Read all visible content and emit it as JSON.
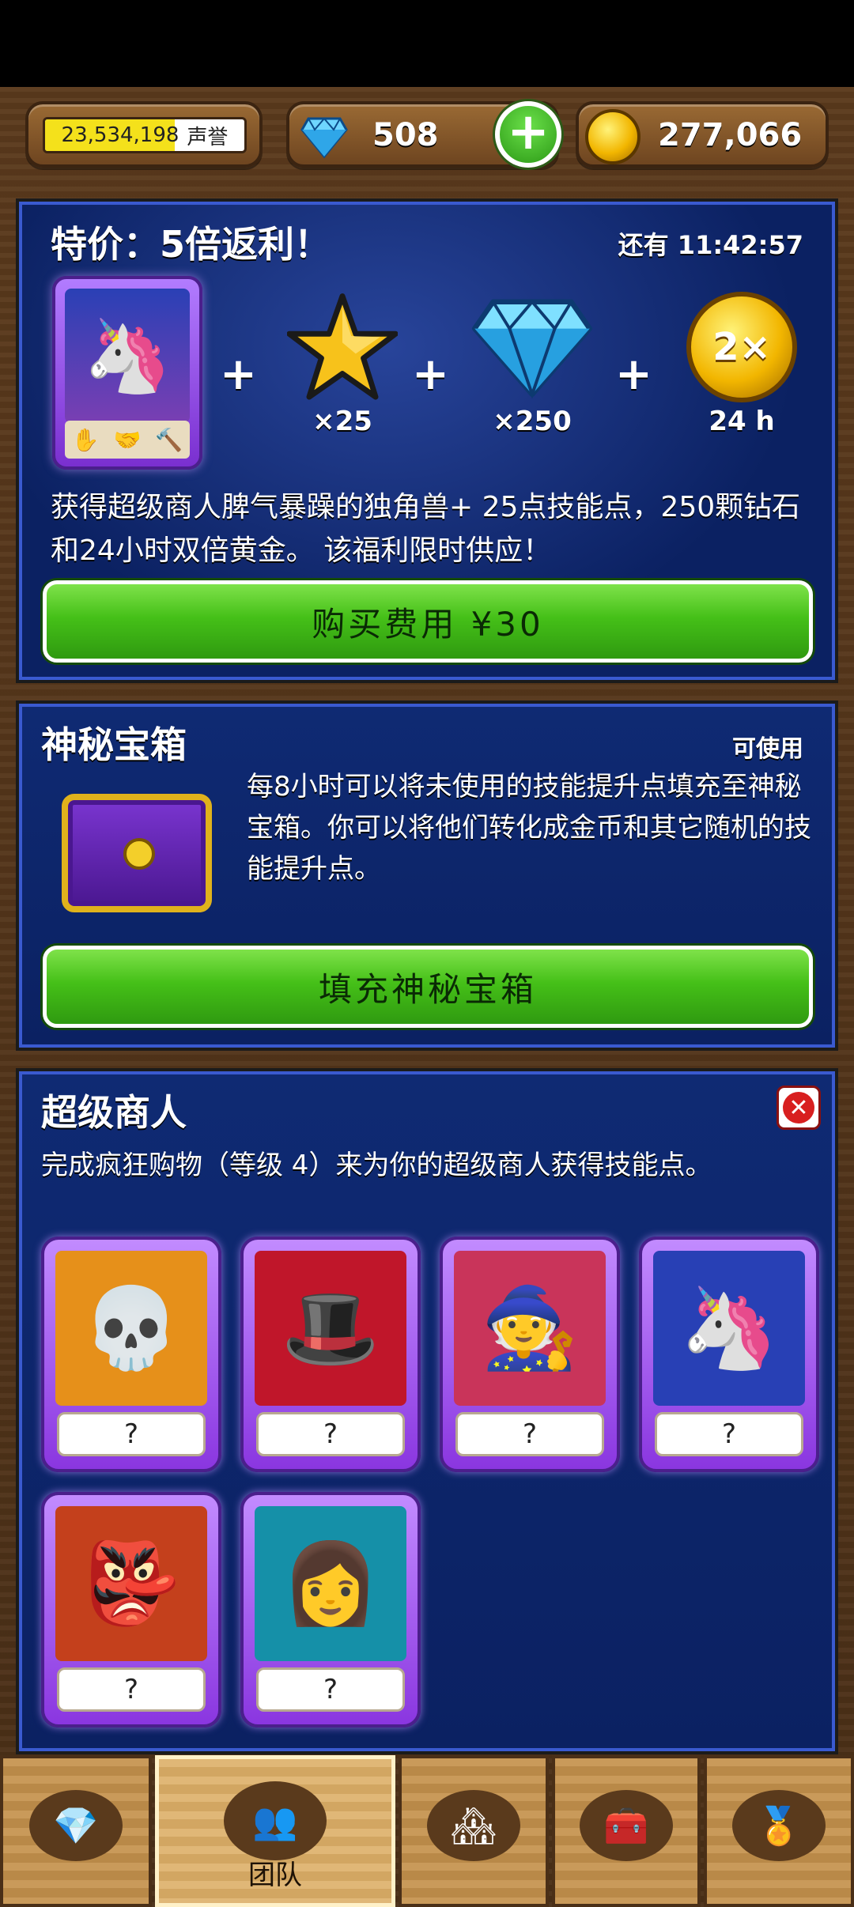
{
  "resources": {
    "reputation_value": "23,534,198",
    "reputation_label": "声誉",
    "reputation_progress": 0.65,
    "gems": "508",
    "coins": "277,066"
  },
  "offer": {
    "title": "特价：5倍返利！",
    "timer": "还有 11:42:57",
    "rewards": [
      {
        "icon": "unicorn-card"
      },
      {
        "icon": "star-icon",
        "qty": "×25"
      },
      {
        "icon": "diamond-icon",
        "qty": "×250"
      },
      {
        "icon": "double-gold-icon",
        "badge": "2×",
        "qty": "24 h"
      }
    ],
    "description": "获得超级商人脾气暴躁的独角兽+ 25点技能点，250颗钻石和24小时双倍黄金。 该福利限时供应！",
    "buy_label": "购买费用 ¥30"
  },
  "chest": {
    "title": "神秘宝箱",
    "status": "可使用",
    "description": "每8小时可以将未使用的技能提升点填充至神秘宝箱。你可以将他们转化成金币和其它随机的技能提升点。",
    "fill_label": "填充神秘宝箱"
  },
  "merchant": {
    "title": "超级商人",
    "description": "完成疯狂购物（等级 4）来为你的超级商人获得技能点。",
    "heroes": [
      {
        "name": "skeleton",
        "value": "?",
        "bg": "#e6901a"
      },
      {
        "name": "gentleman",
        "value": "?",
        "bg": "#c0162a"
      },
      {
        "name": "sage",
        "value": "?",
        "bg": "#c9345a"
      },
      {
        "name": "unicorn",
        "value": "?",
        "bg": "#2840b5"
      },
      {
        "name": "goblin",
        "value": "?",
        "bg": "#c4401c"
      },
      {
        "name": "girl",
        "value": "?",
        "bg": "#1590a8"
      }
    ]
  },
  "nav": {
    "tabs": [
      {
        "icon": "diamond-icon",
        "label": ""
      },
      {
        "icon": "team-icon",
        "label": "团队"
      },
      {
        "icon": "shop-icon",
        "label": ""
      },
      {
        "icon": "chest-icon",
        "label": ""
      },
      {
        "icon": "medal-icon",
        "label": ""
      }
    ]
  }
}
